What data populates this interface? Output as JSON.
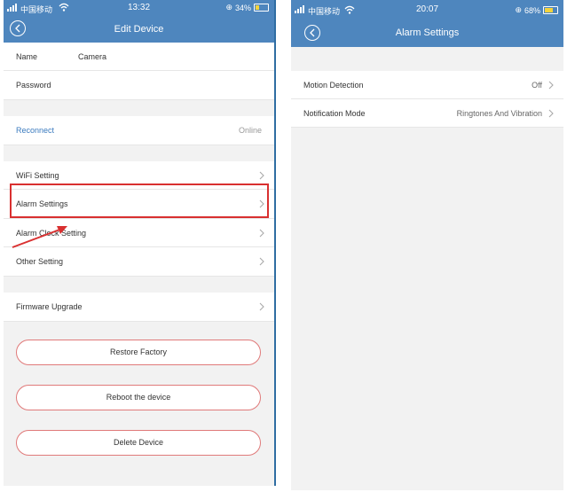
{
  "left_screen": {
    "status": {
      "carrier": "中国移动",
      "time": "13:32",
      "battery": "34%",
      "battery_level": 0.34
    },
    "title": "Edit Device",
    "name_label": "Name",
    "name_value": "Camera",
    "password_label": "Password",
    "reconnect_label": "Reconnect",
    "reconnect_status": "Online",
    "menu": [
      {
        "label": "WiFi Setting"
      },
      {
        "label": "Alarm Settings"
      },
      {
        "label": "Alarm Clock Setting"
      },
      {
        "label": "Other Setting"
      }
    ],
    "firmware_label": "Firmware Upgrade",
    "buttons": {
      "restore": "Restore Factory",
      "reboot": "Reboot the device",
      "delete": "Delete Device"
    }
  },
  "right_screen": {
    "status": {
      "carrier": "中国移动",
      "time": "20:07",
      "battery": "68%",
      "battery_level": 0.68
    },
    "title": "Alarm Settings",
    "rows": [
      {
        "label": "Motion Detection",
        "value": "Off"
      },
      {
        "label": "Notification Mode",
        "value": "Ringtones And Vibration"
      }
    ]
  },
  "colors": {
    "header": "#4e86be",
    "highlight": "#d93030",
    "link": "#3b7bbf",
    "pill_border": "#e07a7a"
  }
}
